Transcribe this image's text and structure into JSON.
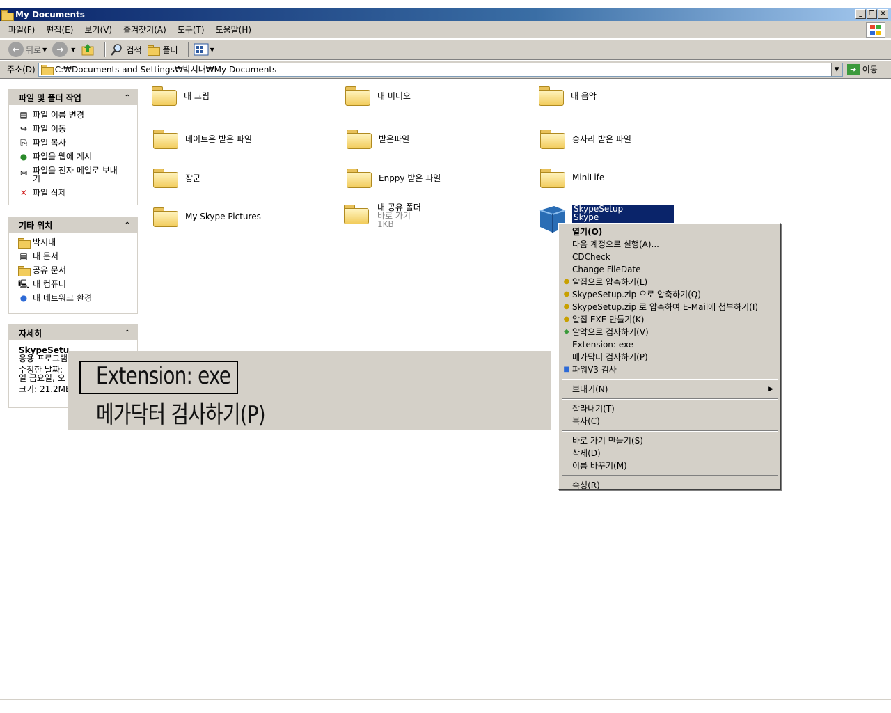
{
  "window": {
    "title": "My Documents"
  },
  "menu": [
    "파일(F)",
    "편집(E)",
    "보기(V)",
    "즐겨찾기(A)",
    "도구(T)",
    "도움말(H)"
  ],
  "toolbar": {
    "back": "뒤로",
    "search": "검색",
    "folders": "폴더"
  },
  "address": {
    "label": "주소(D)",
    "value": "C:₩Documents and Settings₩박시내₩My Documents",
    "go": "이동"
  },
  "tasks_panel": {
    "title": "파일 및 폴더 작업",
    "items": [
      "파일 이름 변경",
      "파일 이동",
      "파일 복사",
      "파일을 웹에 게시",
      "파일을 전자 메일로 보내기",
      "파일 삭제"
    ]
  },
  "places_panel": {
    "title": "기타 위치",
    "items": [
      "박시내",
      "내 문서",
      "공유 문서",
      "내 컴퓨터",
      "내 네트워크 환경"
    ]
  },
  "details_panel": {
    "title": "자세히",
    "name": "SkypeSetu",
    "type": "응용 프로그램",
    "modified_label": "수정한 날짜:",
    "modified_value": "일 금요일, 오",
    "size": "크기: 21.2MB"
  },
  "files": [
    {
      "name": "내 그림",
      "icon": "pictures-folder-icon"
    },
    {
      "name": "내 비디오",
      "icon": "videos-folder-icon"
    },
    {
      "name": "내 음악",
      "icon": "music-folder-icon"
    },
    {
      "name": "네이트온 받은 파일",
      "icon": "folder-icon"
    },
    {
      "name": "받은파일",
      "icon": "folder-icon"
    },
    {
      "name": "송사리 받은 파일",
      "icon": "folder-icon"
    },
    {
      "name": "장군",
      "icon": "folder-icon"
    },
    {
      "name": "Enppy 받은 파일",
      "icon": "folder-icon"
    },
    {
      "name": "MiniLife",
      "icon": "folder-icon"
    },
    {
      "name": "My Skype Pictures",
      "icon": "folder-icon"
    },
    {
      "name": "내 공유 폴더",
      "sub1": "바로 가기",
      "sub2": "1KB",
      "icon": "shared-folder-shortcut-icon"
    },
    {
      "name": "SkypeSetup",
      "sub1": "Skype",
      "icon": "skype-setup-icon"
    }
  ],
  "context_menu": {
    "items": [
      "열기(O)",
      "다음 계정으로 실행(A)...",
      "CDCheck",
      "Change FileDate",
      "알집으로 압축하기(L)",
      "SkypeSetup.zip 으로 압축하기(Q)",
      "SkypeSetup.zip 로 압축하여 E-Mail에 첨부하기(I)",
      "알집 EXE 만들기(K)",
      "알약으로 검사하기(V)",
      "Extension: exe",
      "메가닥터 검사하기(P)",
      "파워V3 검사",
      "보내기(N)",
      "잘라내기(T)",
      "복사(C)",
      "바로 가기 만들기(S)",
      "삭제(D)",
      "이름 바꾸기(M)",
      "속성(R)"
    ]
  },
  "zoom": {
    "line1": "Extension: exe",
    "line2": "메가닥터 검사하기(P)"
  }
}
